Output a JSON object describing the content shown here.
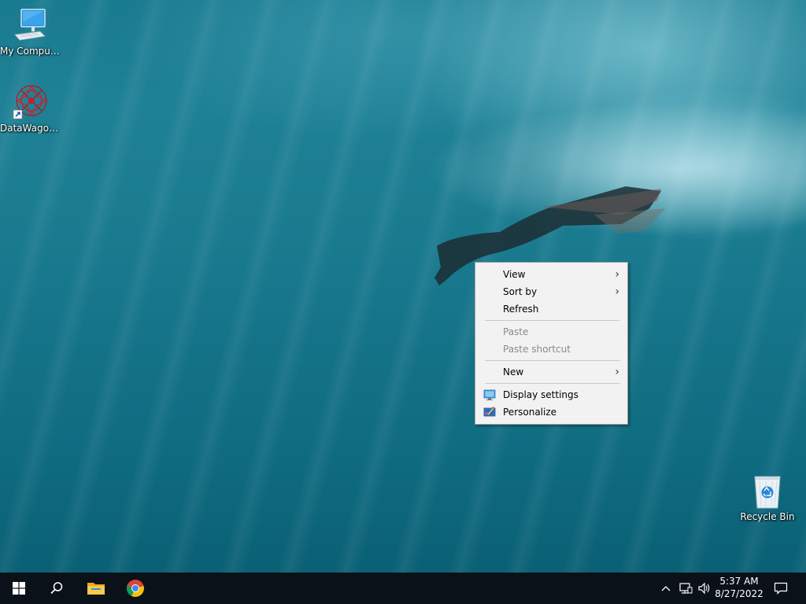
{
  "desktop": {
    "icons": [
      {
        "label": "My Computer",
        "icon": "monitor-icon"
      },
      {
        "label": "DataWagon...",
        "icon": "datawagon-logo-icon"
      },
      {
        "label": "Recycle Bin",
        "icon": "recycle-bin-icon"
      }
    ]
  },
  "context_menu": {
    "items": [
      {
        "label": "View",
        "has_submenu": true,
        "enabled": true
      },
      {
        "label": "Sort by",
        "has_submenu": true,
        "enabled": true
      },
      {
        "label": "Refresh",
        "has_submenu": false,
        "enabled": true
      },
      {
        "label": "Paste",
        "has_submenu": false,
        "enabled": false
      },
      {
        "label": "Paste shortcut",
        "has_submenu": false,
        "enabled": false
      },
      {
        "label": "New",
        "has_submenu": true,
        "enabled": true
      },
      {
        "label": "Display settings",
        "has_submenu": false,
        "enabled": true,
        "icon": "display-settings-icon"
      },
      {
        "label": "Personalize",
        "has_submenu": false,
        "enabled": true,
        "icon": "personalize-icon"
      }
    ],
    "submenu_arrow": "›"
  },
  "taskbar": {
    "buttons": [
      {
        "name": "start",
        "icon": "windows-logo-icon"
      },
      {
        "name": "search",
        "icon": "search-icon"
      },
      {
        "name": "file-explorer",
        "icon": "folder-icon"
      },
      {
        "name": "chrome",
        "icon": "chrome-icon"
      }
    ],
    "tray": {
      "chevron": "^",
      "time": "5:37 AM",
      "date": "8/27/2022"
    }
  },
  "colors": {
    "taskbar_bg": "#0b1118",
    "menu_bg": "#f2f2f2",
    "menu_disabled_text": "#8a8a8a",
    "desktop_water": "#1a7b90"
  }
}
